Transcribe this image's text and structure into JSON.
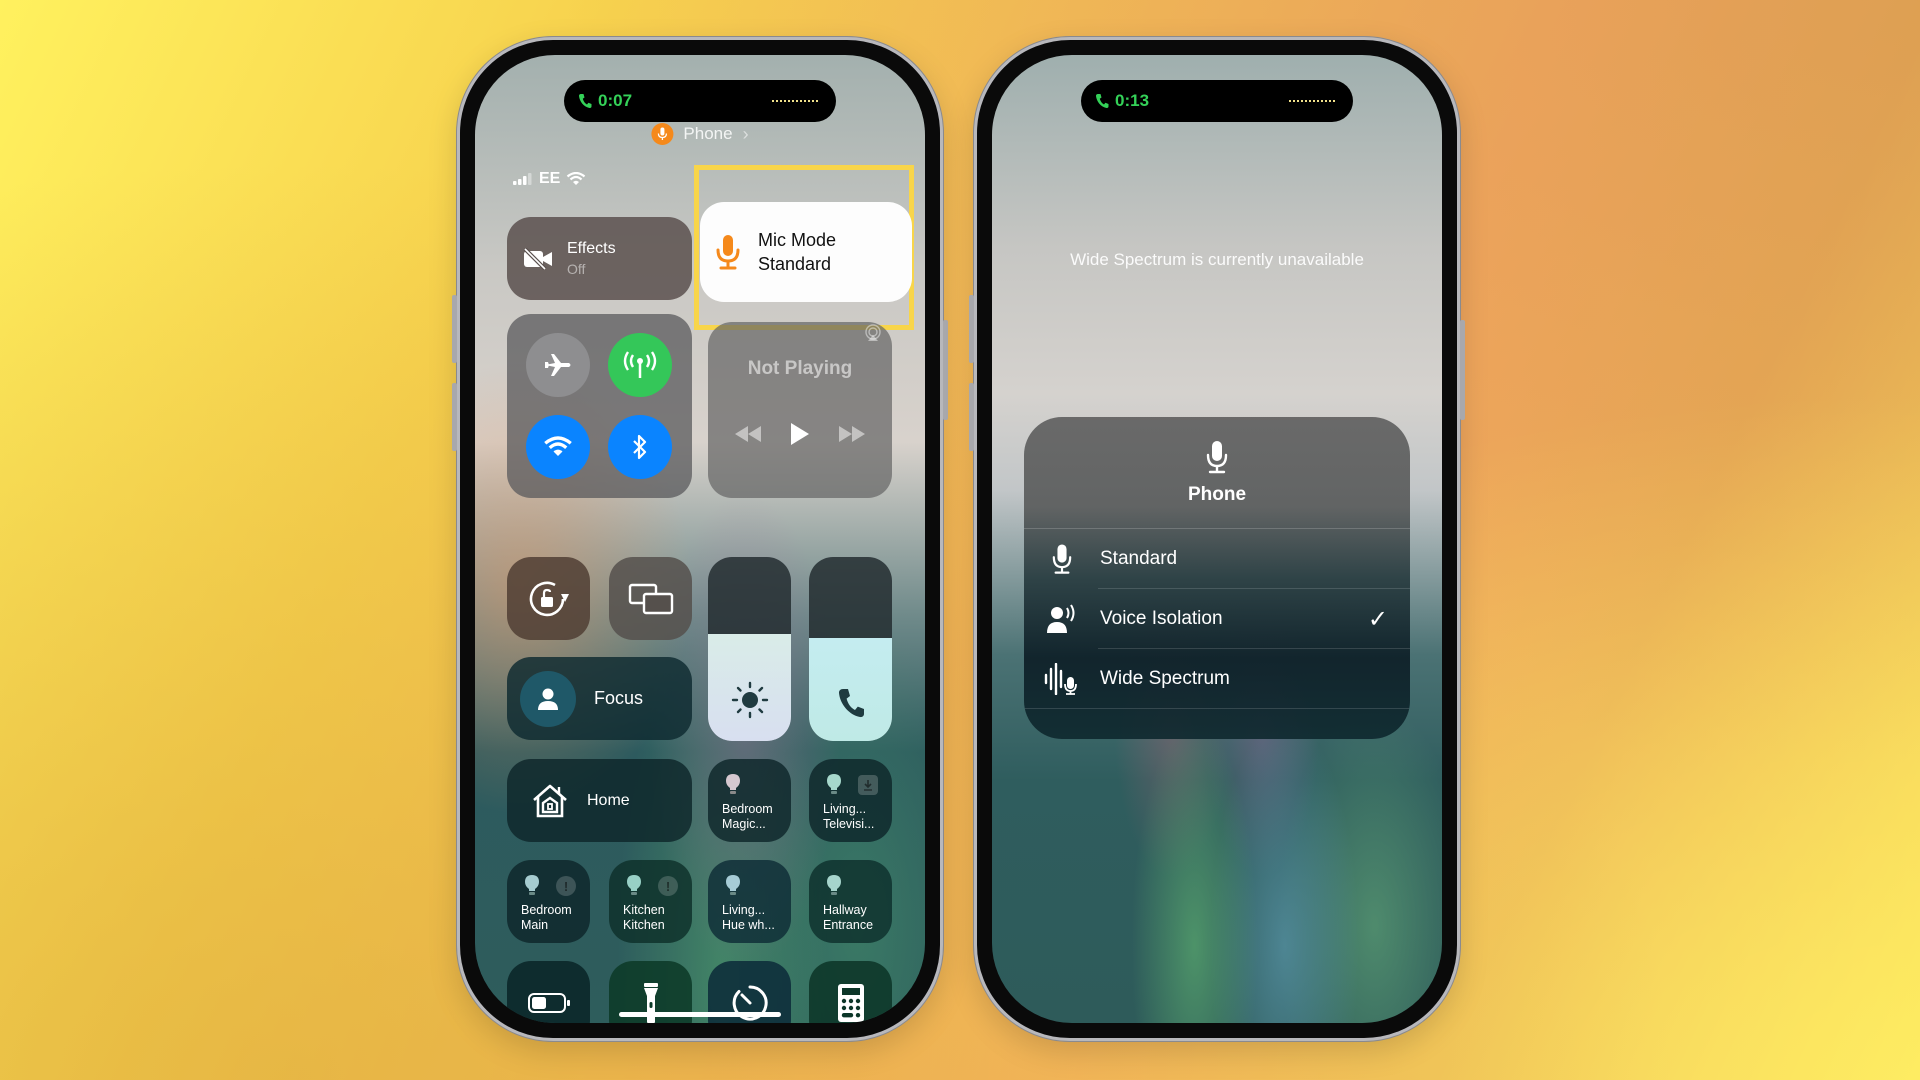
{
  "left_phone": {
    "island": {
      "call_time": "0:07",
      "icon": "phone-call-icon"
    },
    "app_indicator": {
      "label": "Phone",
      "icon": "microphone-icon",
      "accent": "#f5891b"
    },
    "status_bar": {
      "carrier": "EE",
      "icons": [
        "cellular-signal-icon",
        "wifi-icon"
      ]
    },
    "effects": {
      "title": "Effects",
      "value": "Off",
      "icon": "video-off-icon"
    },
    "mic_mode": {
      "title": "Mic Mode",
      "value": "Standard",
      "icon": "microphone-icon",
      "highlight_color": "#f8d54a"
    },
    "connectivity": [
      {
        "name": "airplane-mode",
        "icon": "airplane-icon",
        "active": false,
        "color": "#8e8e90"
      },
      {
        "name": "cellular-data",
        "icon": "antenna-icon",
        "active": true,
        "color": "#34c759"
      },
      {
        "name": "wifi",
        "icon": "wifi-icon",
        "active": true,
        "color": "#0a84ff"
      },
      {
        "name": "bluetooth",
        "icon": "bluetooth-icon",
        "active": true,
        "color": "#0a84ff"
      }
    ],
    "now_playing": {
      "title": "Not Playing",
      "icons": [
        "airplay-icon",
        "rewind-icon",
        "play-icon",
        "fast-forward-icon"
      ]
    },
    "toggles": [
      {
        "name": "orientation-lock",
        "icon": "orientation-lock-icon"
      },
      {
        "name": "screen-mirroring",
        "icon": "screen-mirroring-icon"
      }
    ],
    "sliders": [
      {
        "name": "brightness",
        "icon": "sun-icon",
        "level_percent": 58
      },
      {
        "name": "call-volume",
        "icon": "phone-icon",
        "level_percent": 56
      }
    ],
    "focus": {
      "label": "Focus",
      "icon": "person-icon"
    },
    "home": {
      "label": "Home",
      "icon": "house-icon"
    },
    "accessories": [
      {
        "line1": "Bedroom",
        "line2": "Magic...",
        "badge": ""
      },
      {
        "line1": "Living...",
        "line2": "Televisi...",
        "badge": "download"
      },
      {
        "line1": "Bedroom",
        "line2": "Main",
        "badge": "!"
      },
      {
        "line1": "Kitchen",
        "line2": "Kitchen",
        "badge": "!"
      },
      {
        "line1": "Living...",
        "line2": "Hue wh...",
        "badge": ""
      },
      {
        "line1": "Hallway",
        "line2": "Entrance",
        "badge": ""
      }
    ],
    "bottom_controls": [
      {
        "name": "low-power-mode",
        "icon": "battery-icon"
      },
      {
        "name": "flashlight",
        "icon": "flashlight-icon"
      },
      {
        "name": "timer",
        "icon": "timer-icon"
      },
      {
        "name": "calculator",
        "icon": "calculator-icon"
      }
    ]
  },
  "right_phone": {
    "island": {
      "call_time": "0:13",
      "icon": "phone-call-icon"
    },
    "notice": "Wide Spectrum is currently unavailable",
    "mic_menu": {
      "title": "Phone",
      "icon": "microphone-icon",
      "options": [
        {
          "label": "Standard",
          "icon": "microphone-icon",
          "selected": false
        },
        {
          "label": "Voice Isolation",
          "icon": "voice-isolation-icon",
          "selected": true
        },
        {
          "label": "Wide Spectrum",
          "icon": "wide-spectrum-icon",
          "selected": false
        }
      ],
      "check_glyph": "✓"
    }
  }
}
